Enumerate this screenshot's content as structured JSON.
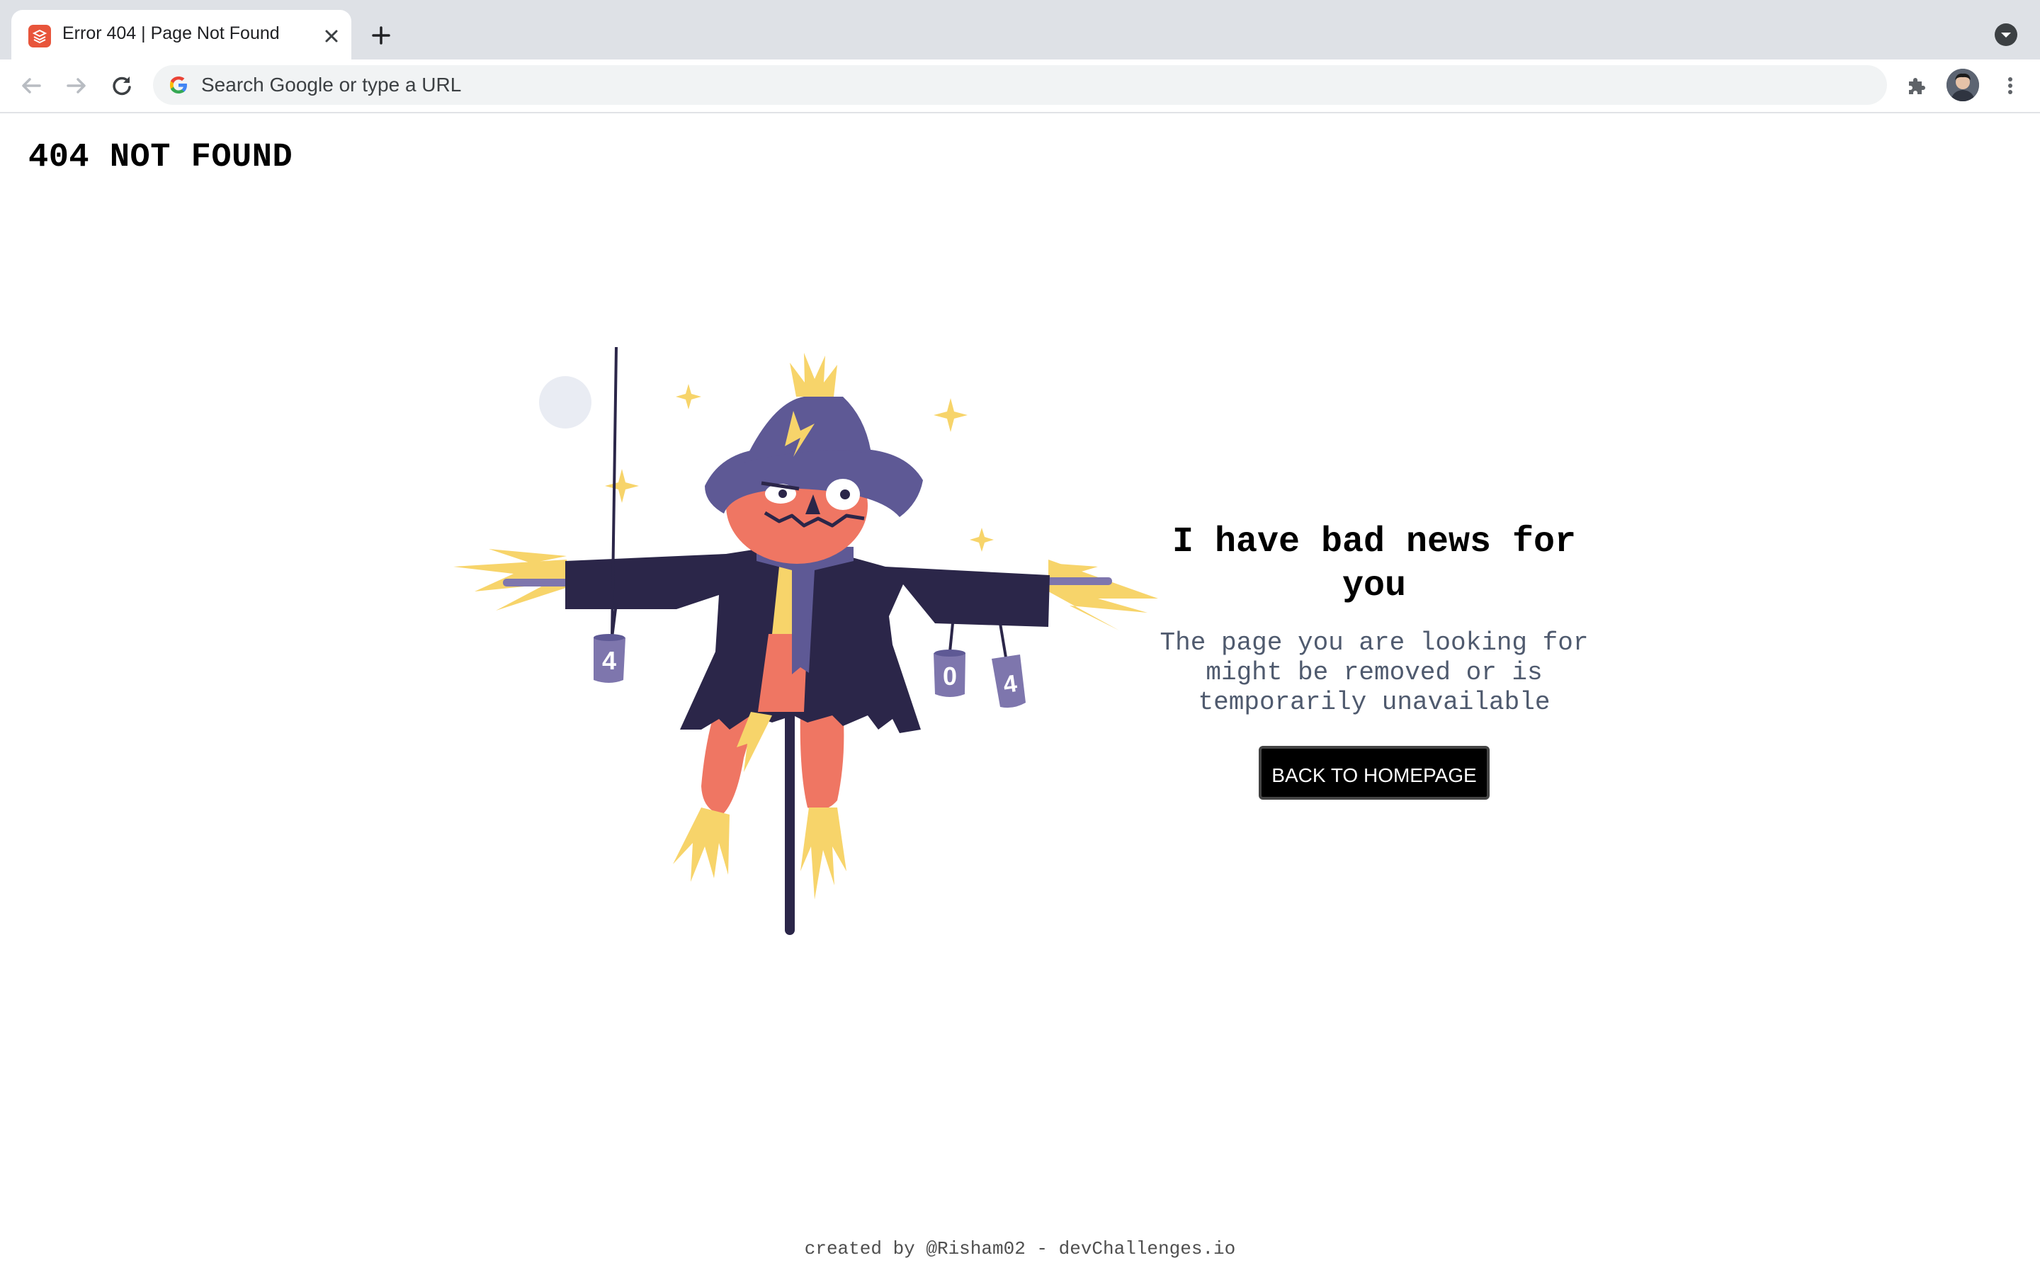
{
  "browser": {
    "tab": {
      "title": "Error 404 | Page Not Found",
      "favicon": "devchallenges-favicon",
      "close_icon": "close-icon"
    },
    "new_tab_icon": "plus-icon",
    "tab_search_icon": "chevron-down-circle-icon",
    "nav": {
      "back_icon": "arrow-left-icon",
      "forward_icon": "arrow-right-icon",
      "reload_icon": "reload-icon"
    },
    "omnibox": {
      "placeholder": "Search Google or type a URL",
      "value": "",
      "icon": "google-g-icon"
    },
    "extensions_icon": "puzzle-piece-icon",
    "profile_icon": "avatar",
    "menu_icon": "kebab-menu-icon"
  },
  "page": {
    "title": "404 NOT FOUND",
    "illustration": {
      "subject": "scarecrow holding cans",
      "can_labels": [
        "4",
        "0",
        "4"
      ]
    },
    "heading": "I have bad news for you",
    "message": "The page you are looking for might be removed or is temporarily unavailable",
    "button_label": "BACK TO HOMEPAGE",
    "footer": "created by @Risham02 - devChallenges.io"
  },
  "colors": {
    "accent_orange": "#ef7663",
    "hat_purple": "#5e5995",
    "coat_navy": "#2b2649",
    "straw_yellow": "#f7d46a",
    "can_purple": "#7e76ad",
    "moon": "#e9ecf3"
  }
}
